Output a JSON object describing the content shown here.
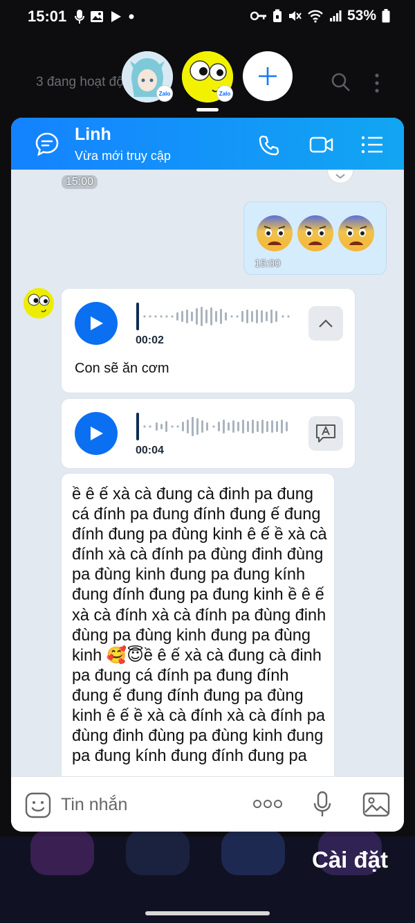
{
  "status_bar": {
    "time": "15:01",
    "battery": "53%"
  },
  "background": {
    "header_text": "3 đang hoạt động",
    "settings_label": "Cài đặt"
  },
  "chat_heads": [
    {
      "name": "anime-avatar",
      "badge": "Zalo"
    },
    {
      "name": "googly-eye-avatar",
      "badge": "Zalo"
    }
  ],
  "chat": {
    "contact_name": "Linh",
    "contact_status": "Vừa mới truy cập",
    "time_top": "15:00",
    "my_message": {
      "emojis": [
        "anxious-face",
        "anxious-face",
        "anxious-face"
      ],
      "time": "15:00"
    },
    "voice_1": {
      "duration": "00:02",
      "transcript": "Con sẽ ăn cơm"
    },
    "voice_2": {
      "duration": "00:04"
    },
    "long_text": "ề ê ế xà cà đung cà đinh pa đung cá đính pa đung đính đung ế đung đính đung pa đùng kinh ê ế ề xà cà đính xà cà đính pa đùng đinh đùng pa đùng kinh đung pa đung kính đung đính đung pa đung kinh ề ê ế xà cà đính xà cà đính pa đùng đinh đùng pa đùng kinh đung pa đùng kinh 🥰😇ề ê ế xà cà đung cà đinh pa đung cá đính pa đung đính đung ế đung đính đung pa đùng kinh ê ế ề xà cà đính xà cà đính pa đùng đinh đùng pa đùng kinh đung pa đung kính đung đính đung pa",
    "input_placeholder": "Tin nhắn"
  },
  "colors": {
    "header_gradient_start": "#1482ff",
    "header_gradient_end": "#12a6f2",
    "play_button": "#0b6ff2",
    "panel_bg": "#e2e9f1",
    "my_bubble": "#d5ecfd"
  }
}
